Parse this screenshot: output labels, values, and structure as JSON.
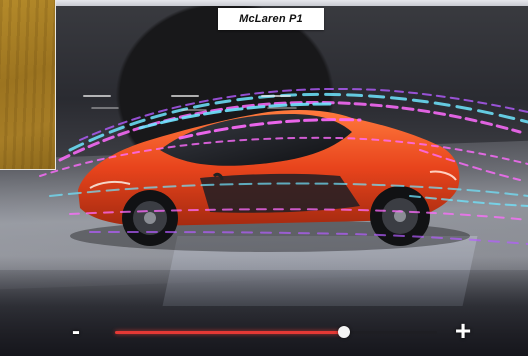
{
  "header": {
    "logo_text": "McLaren P1"
  },
  "car": {
    "body_color": "#e8441c",
    "accent_color": "#1e1f24"
  },
  "airflow": {
    "colors": [
      "#ff6cff",
      "#6fe6ff",
      "#b45cff"
    ]
  },
  "zoom": {
    "minus_label": "-",
    "plus_label": "+",
    "level": 0.71,
    "fill_color": "#e53935"
  }
}
